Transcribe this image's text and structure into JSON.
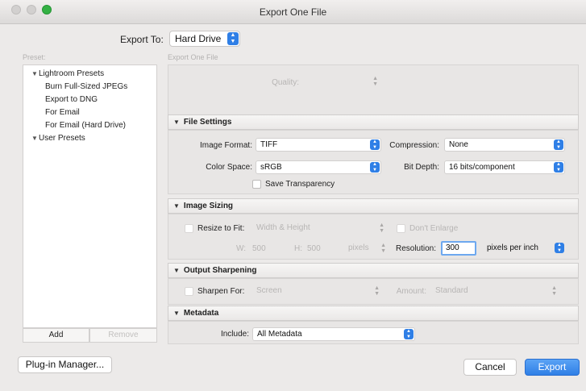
{
  "window": {
    "title": "Export One File"
  },
  "export_to": {
    "label": "Export To:",
    "value": "Hard Drive"
  },
  "preset_panel": {
    "label": "Preset:",
    "items": [
      {
        "label": "Lightroom Presets",
        "is_group": true
      },
      {
        "label": "Burn Full-Sized JPEGs",
        "is_group": false
      },
      {
        "label": "Export to DNG",
        "is_group": false
      },
      {
        "label": "For Email",
        "is_group": false
      },
      {
        "label": "For Email (Hard Drive)",
        "is_group": false
      },
      {
        "label": "User Presets",
        "is_group": true
      }
    ],
    "add_label": "Add",
    "remove_label": "Remove"
  },
  "main": {
    "region_label": "Export One File",
    "quality": {
      "label": "Quality:"
    },
    "file_settings": {
      "title": "File Settings",
      "image_format": {
        "label": "Image Format:",
        "value": "TIFF"
      },
      "compression": {
        "label": "Compression:",
        "value": "None"
      },
      "color_space": {
        "label": "Color Space:",
        "value": "sRGB"
      },
      "bit_depth": {
        "label": "Bit Depth:",
        "value": "16 bits/component"
      },
      "save_transparency": "Save Transparency"
    },
    "image_sizing": {
      "title": "Image Sizing",
      "resize_label": "Resize to Fit:",
      "resize_value": "Width & Height",
      "dont_enlarge": "Don't Enlarge",
      "w_label": "W:",
      "w_value": "500",
      "h_label": "H:",
      "h_value": "500",
      "units": "pixels",
      "resolution_label": "Resolution:",
      "resolution_value": "300",
      "resolution_units": "pixels per inch"
    },
    "output_sharpening": {
      "title": "Output Sharpening",
      "sharpen_label": "Sharpen For:",
      "sharpen_value": "Screen",
      "amount_label": "Amount:",
      "amount_value": "Standard"
    },
    "metadata": {
      "title": "Metadata",
      "include_label": "Include:",
      "include_value": "All Metadata"
    }
  },
  "footer": {
    "plugin_manager": "Plug-in Manager...",
    "cancel": "Cancel",
    "export": "Export"
  },
  "colors": {
    "accent": "#2f7fe6",
    "zoom_button": "#34b144"
  }
}
